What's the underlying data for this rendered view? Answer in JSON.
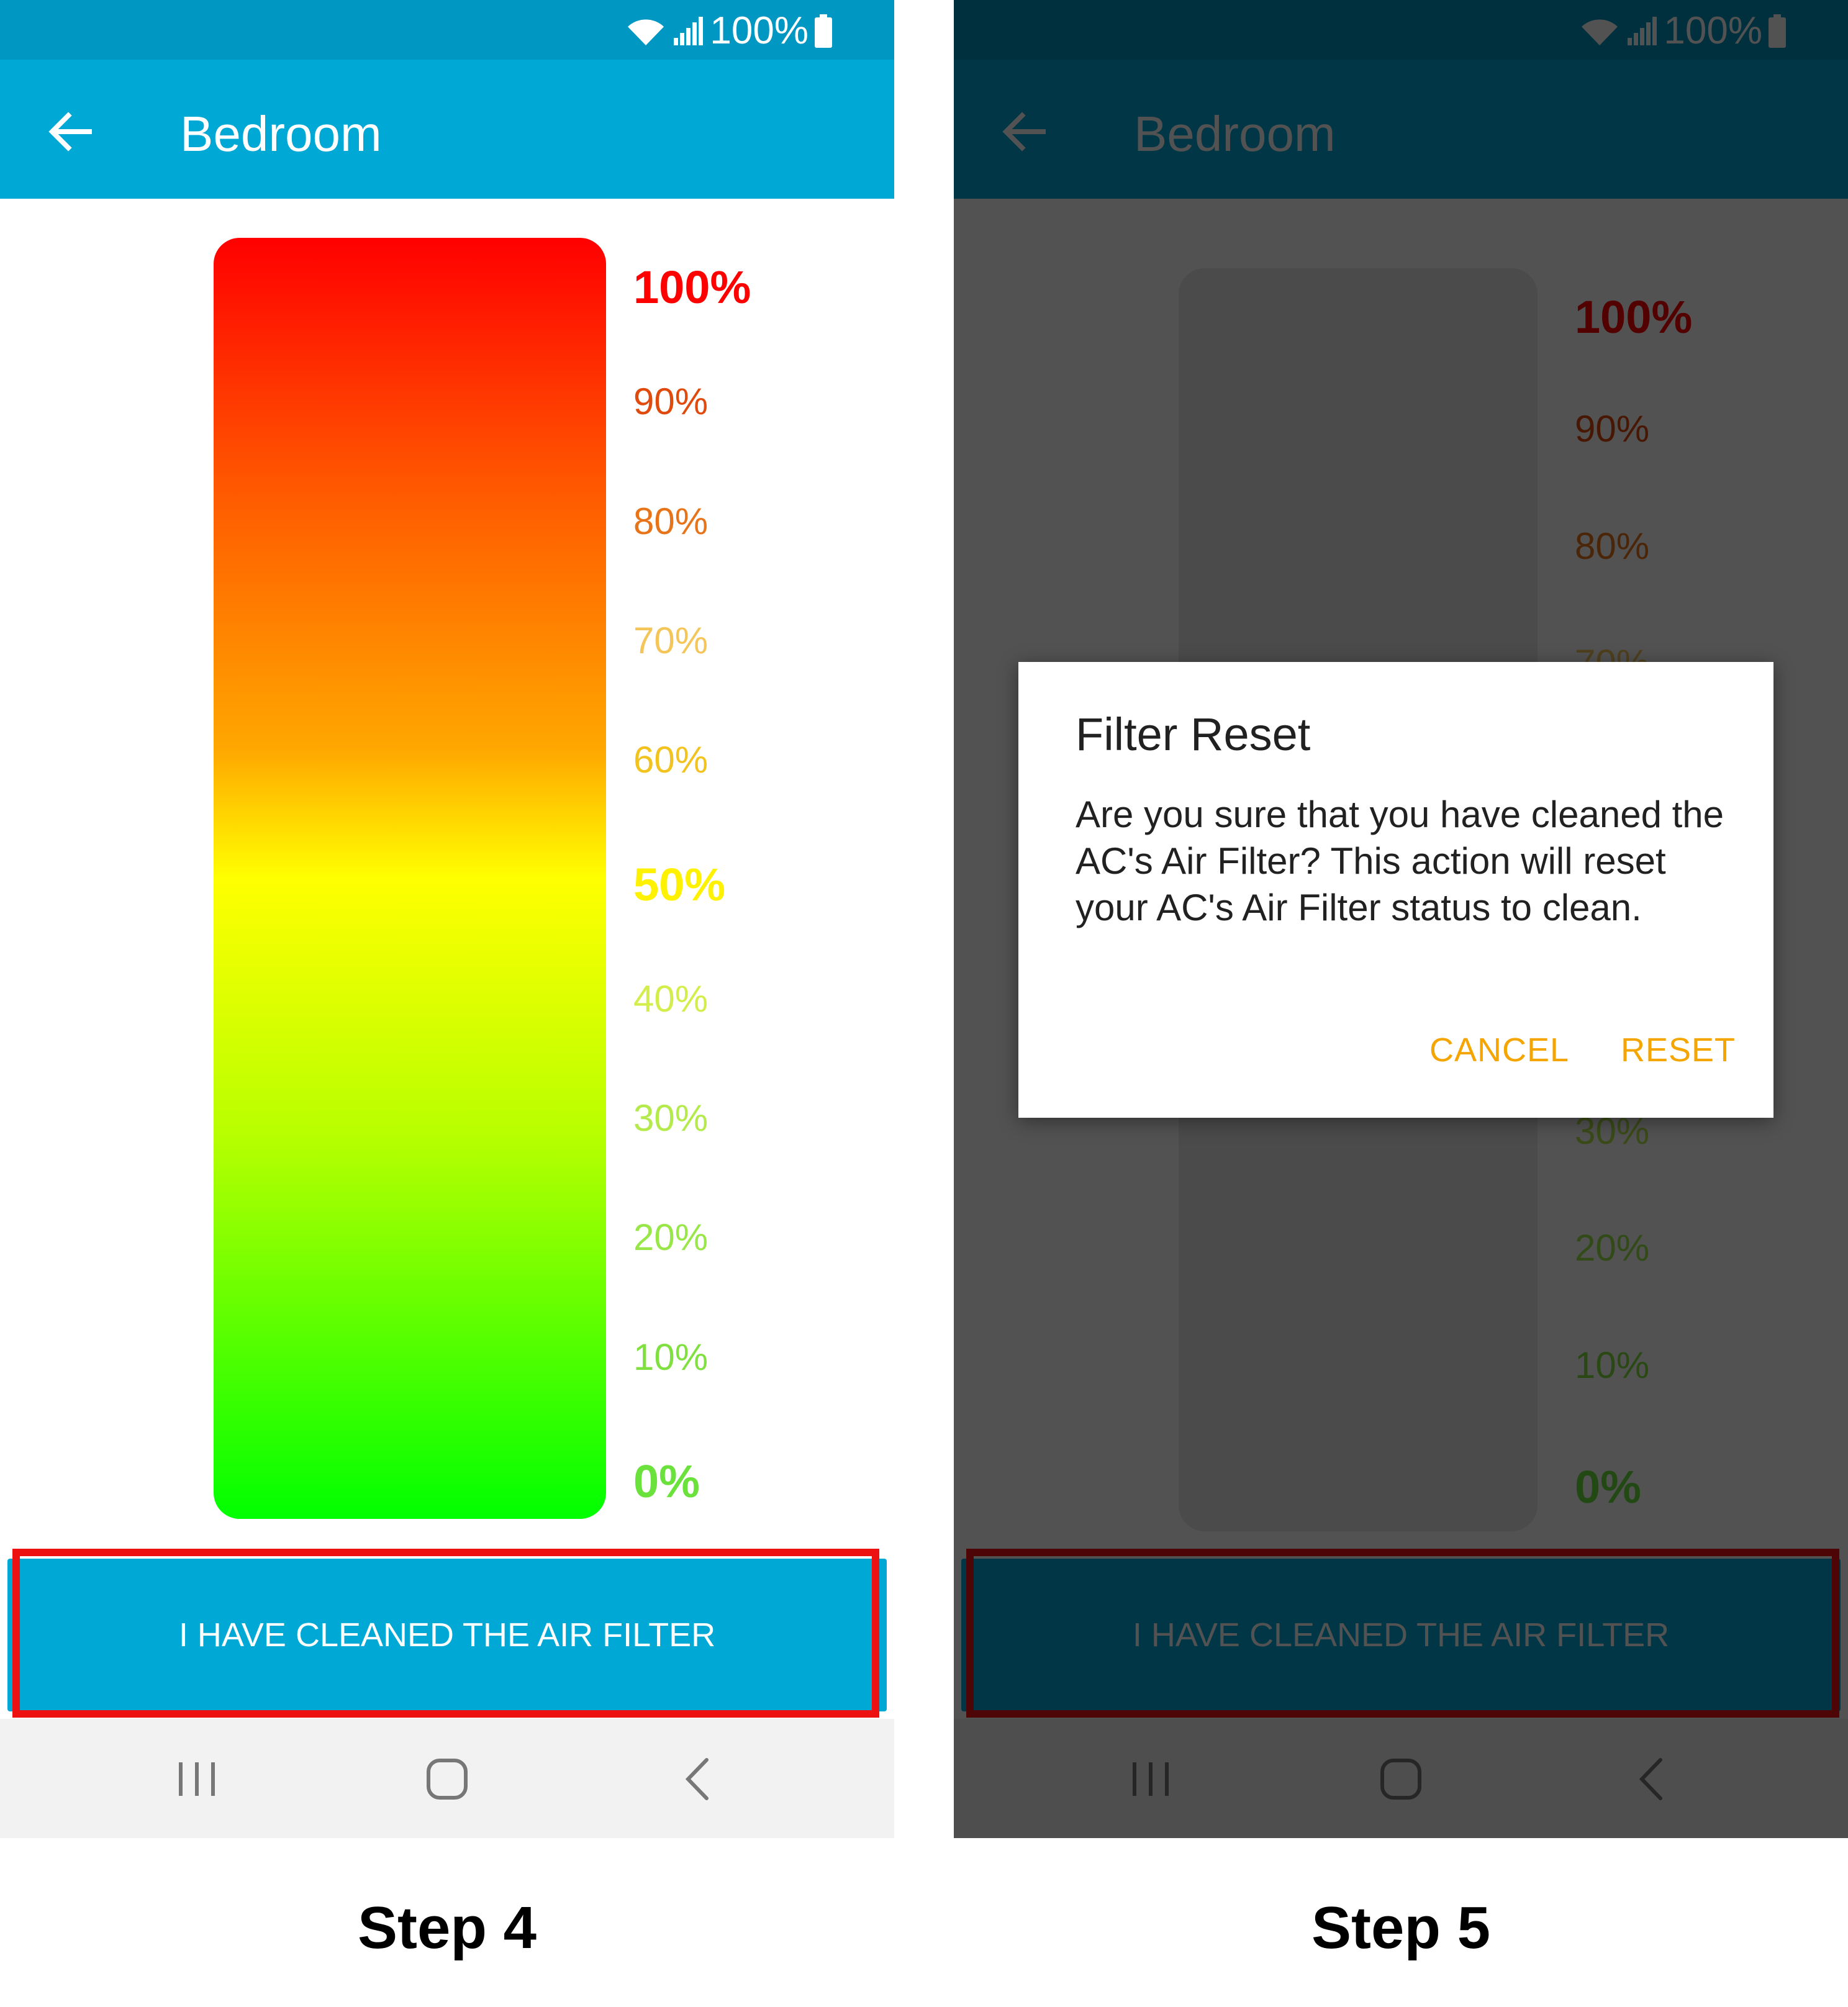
{
  "status": {
    "battery_text": "100%"
  },
  "appbar": {
    "title": "Bedroom"
  },
  "gauge": {
    "scale": [
      {
        "text": "100%",
        "color": "#FF0000",
        "bold": true
      },
      {
        "text": "90%",
        "color": "#E04A0C",
        "bold": false
      },
      {
        "text": "80%",
        "color": "#E8741A",
        "bold": false
      },
      {
        "text": "70%",
        "color": "#F4C65A",
        "bold": false
      },
      {
        "text": "60%",
        "color": "#F2C21E",
        "bold": false
      },
      {
        "text": "50%",
        "color": "#FFF200",
        "bold": true
      },
      {
        "text": "40%",
        "color": "#D2EE4A",
        "bold": false
      },
      {
        "text": "30%",
        "color": "#B4EA4C",
        "bold": false
      },
      {
        "text": "20%",
        "color": "#98E648",
        "bold": false
      },
      {
        "text": "10%",
        "color": "#80E040",
        "bold": false
      },
      {
        "text": "0%",
        "color": "#6BE23C",
        "bold": true
      }
    ],
    "gradient_colors": [
      "#FF0000",
      "#FFA800",
      "#FFFF00",
      "#00FF00"
    ]
  },
  "cta": {
    "label": "I HAVE CLEANED THE AIR FILTER"
  },
  "dialog": {
    "title": "Filter Reset",
    "body": "Are you sure that you have cleaned the AC's Air Filter? This action will reset your AC's Air Filter status to clean.",
    "cancel_label": "CANCEL",
    "reset_label": "RESET"
  },
  "captions": {
    "step4": "Step 4",
    "step5": "Step 5"
  },
  "colors": {
    "accent": "#00A8D6",
    "statusbar": "#0097C2",
    "highlight": "#EE1111",
    "dialog_button": "#F5A500"
  },
  "icons": [
    "wifi-icon",
    "signal-icon",
    "battery-icon",
    "back-arrow-icon",
    "recents-icon",
    "home-icon",
    "nav-back-icon"
  ]
}
